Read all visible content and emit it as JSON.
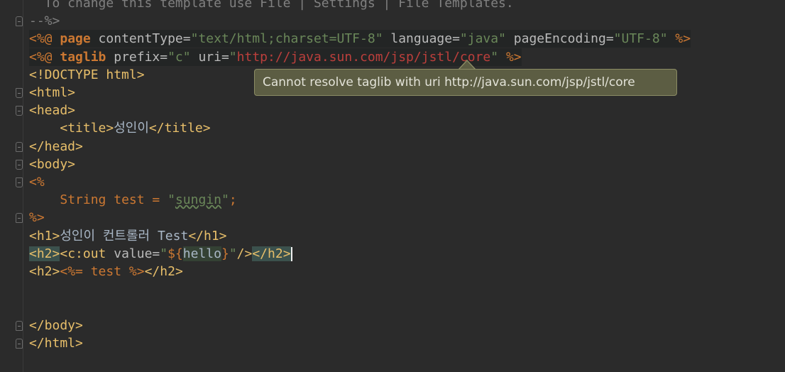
{
  "editor": {
    "language": "JSP",
    "lines": [
      {
        "tokens": [
          {
            "t": "  To change this template use File | Settings | File Templates.",
            "c": "t-comment"
          }
        ]
      },
      {
        "tokens": [
          {
            "t": "--%>",
            "c": "t-comment"
          }
        ]
      },
      {
        "tokens": [
          {
            "t": "<%@ ",
            "c": "t-jsp"
          },
          {
            "t": "page",
            "c": "t-kw"
          },
          {
            "t": " contentType=",
            "c": "t-attr"
          },
          {
            "t": "\"text/html;charset=UTF-8\"",
            "c": "t-str"
          },
          {
            "t": " language=",
            "c": "t-attr"
          },
          {
            "t": "\"java\"",
            "c": "t-str"
          },
          {
            "t": " pageEncoding=",
            "c": "t-attr"
          },
          {
            "t": "\"UTF-8\"",
            "c": "t-str"
          },
          {
            "t": " %>",
            "c": "t-jsp"
          }
        ],
        "highlight": true
      },
      {
        "tokens": [
          {
            "t": "<%@ ",
            "c": "t-jsp"
          },
          {
            "t": "taglib",
            "c": "t-kw"
          },
          {
            "t": " prefix=",
            "c": "t-attr"
          },
          {
            "t": "\"c\"",
            "c": "t-str"
          },
          {
            "t": " uri=",
            "c": "t-attr"
          },
          {
            "t": "\"",
            "c": "t-str"
          },
          {
            "t": "http://java.sun.com/jsp/jstl/core",
            "c": "t-err"
          },
          {
            "t": "\"",
            "c": "t-str"
          },
          {
            "t": " %>",
            "c": "t-jsp"
          }
        ],
        "highlight": true
      },
      {
        "tokens": [
          {
            "t": "<!DOCTYPE html>",
            "c": "t-tag"
          }
        ]
      },
      {
        "tokens": [
          {
            "t": "<html>",
            "c": "t-tag"
          }
        ]
      },
      {
        "tokens": [
          {
            "t": "<head>",
            "c": "t-tag"
          }
        ]
      },
      {
        "tokens": [
          {
            "t": "    ",
            "c": "t-text"
          },
          {
            "t": "<title>",
            "c": "t-tag"
          },
          {
            "t": "성인이",
            "c": "t-text"
          },
          {
            "t": "</title>",
            "c": "t-tag"
          }
        ]
      },
      {
        "tokens": [
          {
            "t": "</head>",
            "c": "t-tag"
          }
        ]
      },
      {
        "tokens": [
          {
            "t": "<body>",
            "c": "t-tag"
          }
        ]
      },
      {
        "tokens": [
          {
            "t": "<%",
            "c": "t-jsp"
          }
        ]
      },
      {
        "tokens": [
          {
            "t": "    ",
            "c": "t-text"
          },
          {
            "t": "String",
            "c": "t-kwn"
          },
          {
            "t": " test = ",
            "c": "t-kwn"
          },
          {
            "t": "\"",
            "c": "t-str"
          },
          {
            "t": "sungin",
            "c": "t-str t-typo"
          },
          {
            "t": "\"",
            "c": "t-str"
          },
          {
            "t": ";",
            "c": "t-kwn"
          }
        ]
      },
      {
        "tokens": [
          {
            "t": "%>",
            "c": "t-jsp"
          }
        ]
      },
      {
        "tokens": [
          {
            "t": "<h1>",
            "c": "t-tag"
          },
          {
            "t": "성인이 컨트롤러 Test",
            "c": "t-text"
          },
          {
            "t": "</h1>",
            "c": "t-tag"
          }
        ]
      },
      {
        "tokens": [
          {
            "t": "<h2>",
            "c": "t-tag bracket-match"
          },
          {
            "t": "<c:out",
            "c": "t-tag"
          },
          {
            "t": " value=",
            "c": "t-attr"
          },
          {
            "t": "\"",
            "c": "t-str"
          },
          {
            "t": "${",
            "c": "t-elbrace"
          },
          {
            "t": "hello",
            "c": "t-el"
          },
          {
            "t": "}",
            "c": "t-elbrace"
          },
          {
            "t": "\"",
            "c": "t-str"
          },
          {
            "t": "/>",
            "c": "t-tag"
          },
          {
            "t": "</h2>",
            "c": "t-tag bracket-match"
          }
        ],
        "caret": true
      },
      {
        "tokens": [
          {
            "t": "<h2>",
            "c": "t-tag"
          },
          {
            "t": "<%=",
            "c": "t-jsp"
          },
          {
            "t": " test ",
            "c": "t-kwn"
          },
          {
            "t": "%>",
            "c": "t-jsp"
          },
          {
            "t": "</h2>",
            "c": "t-tag"
          }
        ]
      },
      {
        "tokens": []
      },
      {
        "tokens": []
      },
      {
        "tokens": [
          {
            "t": "</body>",
            "c": "t-tag"
          }
        ]
      },
      {
        "tokens": [
          {
            "t": "</html>",
            "c": "t-tag"
          }
        ]
      }
    ]
  },
  "tooltip": {
    "text": "Cannot resolve taglib with uri http://java.sun.com/jsp/jstl/core"
  },
  "colors": {
    "background": "#2b2b2b",
    "tag": "#e8bf6a",
    "keyword": "#cc7832",
    "string": "#6a8759",
    "error": "#bc3f3c",
    "tooltip_background": "#5c5d43"
  }
}
